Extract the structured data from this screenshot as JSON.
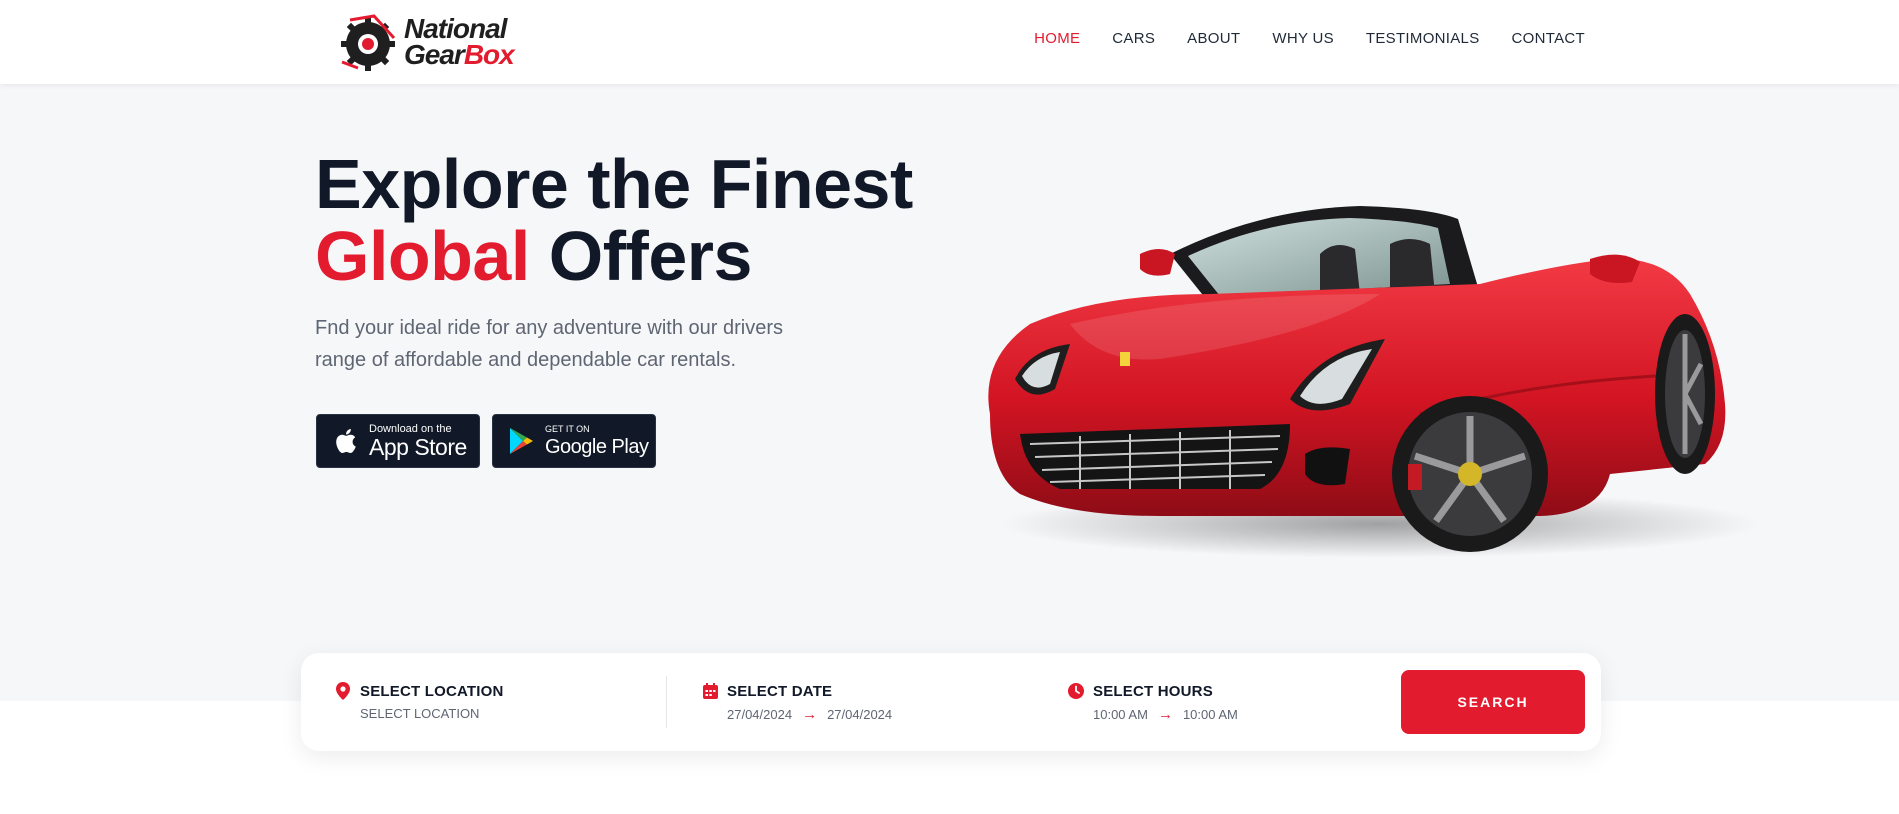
{
  "brand": {
    "line1": "National",
    "line2_a": "Gear",
    "line2_b": "Box",
    "accent_color": "#e31b2f",
    "gear_icon": "gear-logo-icon"
  },
  "nav": [
    {
      "label": "HOME",
      "active": true
    },
    {
      "label": "CARS",
      "active": false
    },
    {
      "label": "ABOUT",
      "active": false
    },
    {
      "label": "WHY US",
      "active": false
    },
    {
      "label": "TESTIMONIALS",
      "active": false
    },
    {
      "label": "CONTACT",
      "active": false
    }
  ],
  "hero": {
    "headline_line1": "Explore the Finest",
    "headline_red": "Global",
    "headline_rest": "Offers",
    "subtext": "Fnd your ideal ride for any adventure with our drivers range of affordable and dependable car rentals.",
    "appstore": {
      "small": "Download on the",
      "big": "App Store",
      "icon": "apple-icon"
    },
    "googleplay": {
      "small": "GET IT ON",
      "big": "Google Play",
      "icon": "google-play-icon"
    },
    "car_image": "red-convertible-sports-car"
  },
  "search": {
    "location": {
      "title": "SELECT LOCATION",
      "value": "SELECT LOCATION",
      "icon": "location-pin-icon"
    },
    "date": {
      "title": "SELECT DATE",
      "from": "27/04/2024",
      "to": "27/04/2024",
      "icon": "calendar-icon"
    },
    "hours": {
      "title": "SELECT HOURS",
      "from": "10:00 AM",
      "to": "10:00 AM",
      "icon": "clock-icon"
    },
    "button": "SEARCH"
  },
  "colors": {
    "accent": "#e31b2f",
    "dark": "#111827",
    "hero_bg": "#f6f7f9"
  }
}
